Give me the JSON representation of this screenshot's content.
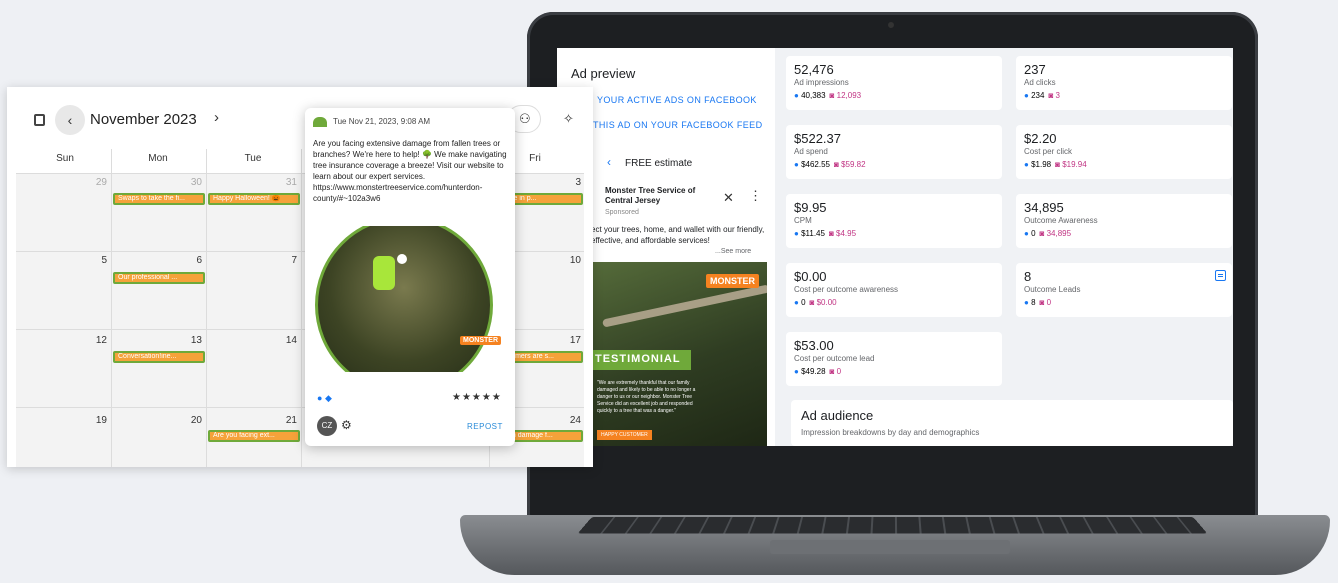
{
  "ad_preview": {
    "title": "Ad preview",
    "link_active": "YOUR ACTIVE ADS ON FACEBOOK",
    "link_feed": "THIS AD ON YOUR FACEBOOK FEED",
    "nav_label": "FREE estimate",
    "brand": "Monster Tree Service of Central Jersey",
    "sponsored": "Sponsored",
    "copy": "ect your trees, home, and wallet with our friendly, effective, and affordable services!",
    "see_more": "...See more",
    "photo_logo": "MONSTER",
    "photo_banner": "TESTIMONIAL",
    "photo_quote": "\"We are extremely thankful that our family damaged and likely to be able to no longer a danger to us or our neighbor. Monster Tree Service did an excellent job and responded quickly to a tree that was a danger.\"",
    "photo_tag": "HAPPY CUSTOMER"
  },
  "metrics": [
    {
      "value": "52,476",
      "label": "Ad impressions",
      "fb": "40,383",
      "ig": "12,093"
    },
    {
      "value": "237",
      "label": "Ad clicks",
      "fb": "234",
      "ig": "3"
    },
    {
      "value": "$522.37",
      "label": "Ad spend",
      "fb": "$462.55",
      "ig": "$59.82"
    },
    {
      "value": "$2.20",
      "label": "Cost per click",
      "fb": "$1.98",
      "ig": "$19.94"
    },
    {
      "value": "$9.95",
      "label": "CPM",
      "fb": "$11.45",
      "ig": "$4.95"
    },
    {
      "value": "34,895",
      "label": "Outcome Awareness",
      "fb": "0",
      "ig": "34,895"
    },
    {
      "value": "$0.00",
      "label": "Cost per outcome awareness",
      "fb": "0",
      "ig": "$0.00"
    },
    {
      "value": "8",
      "label": "Outcome Leads",
      "fb": "8",
      "ig": "0"
    },
    {
      "value": "$53.00",
      "label": "Cost per outcome lead",
      "fb": "$49.28",
      "ig": "0"
    }
  ],
  "audience": {
    "title": "Ad audience",
    "subtitle": "Impression breakdowns by day and demographics"
  },
  "calendar": {
    "month": "November 2023",
    "weekdays": [
      "Sun",
      "Mon",
      "Tue",
      "Fri"
    ],
    "days": {
      "r0": [
        "29",
        "30",
        "31",
        "3"
      ],
      "r1": [
        "5",
        "6",
        "7",
        "10"
      ],
      "r2": [
        "12",
        "13",
        "14",
        "17"
      ],
      "r3": [
        "19",
        "20",
        "21",
        "24"
      ]
    },
    "events": [
      "Swaps to take the fi...",
      "Happy Halloween! 🎃",
      "...pride in p...",
      "Our professional ...",
      "Conversation!ine...",
      "...ustomers are s...",
      "Are you facing ext...",
      "...trom damage f..."
    ]
  },
  "popup": {
    "timestamp": "Tue Nov 21, 2023, 9:08 AM",
    "body": "Are you facing extensive damage from fallen trees or branches? We're here to help! 🌳 We make navigating tree insurance coverage a breeze! Visit our website to learn about our expert services. https://www.monstertreeservice.com/hunterdon-county/#~102a3w6",
    "image_logo": "MONSTER",
    "stars": "★★★★★",
    "avatar": "CZ",
    "repost": "REPOST"
  }
}
